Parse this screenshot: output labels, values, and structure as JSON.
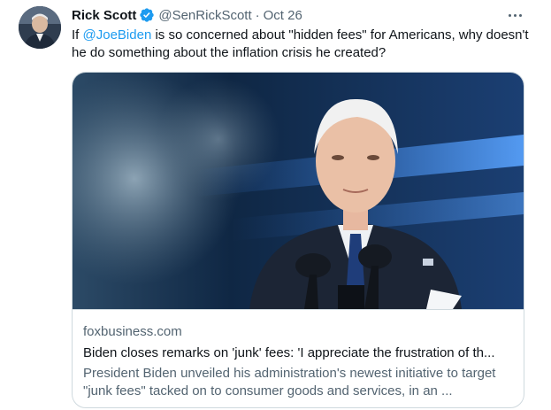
{
  "tweet": {
    "author_name": "Rick Scott",
    "handle": "@SenRickScott",
    "separator": "·",
    "date": "Oct 26",
    "text_prefix": "If ",
    "mention": "@JoeBiden",
    "text_suffix": " is so concerned about \"hidden fees\" for Americans, why doesn't he do something about the inflation crisis he created?",
    "card": {
      "domain": "foxbusiness.com",
      "title": "Biden closes remarks on 'junk' fees: 'I appreciate the frustration of th...",
      "description": "President Biden unveiled his administration's newest initiative to target \"junk fees\" tacked on to consumer goods and services, in an ..."
    }
  },
  "icons": {
    "verified": "verified-badge-icon",
    "more": "more-options-icon"
  },
  "colors": {
    "accent": "#1d9bf0",
    "secondary_text": "#536471",
    "border": "#cfd9de"
  }
}
